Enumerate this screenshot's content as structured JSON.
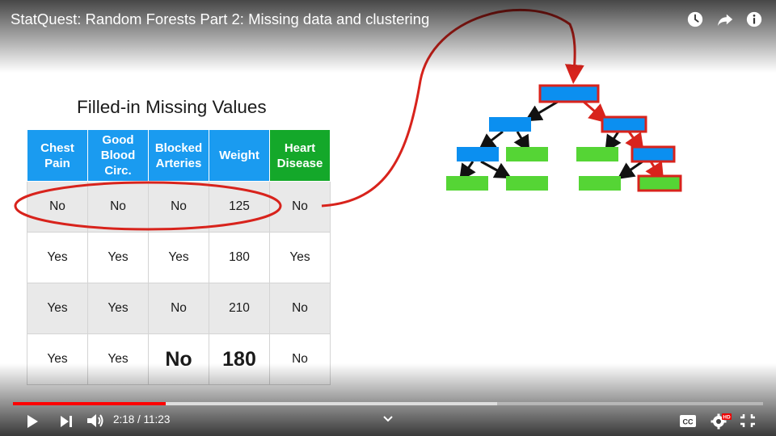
{
  "video": {
    "title": "StatQuest: Random Forests Part 2: Missing data and clustering",
    "current_time": "2:18",
    "separator": " / ",
    "duration": "11:23",
    "progress_fraction": 0.204,
    "buffered_fraction": 0.645
  },
  "slide": {
    "title": "Filled-in Missing Values",
    "headers": [
      "Chest\nPain",
      "Good\nBlood\nCirc.",
      "Blocked\nArteries",
      "Weight",
      "Heart\nDisease"
    ],
    "rows": [
      [
        "No",
        "No",
        "No",
        "125",
        "No"
      ],
      [
        "Yes",
        "Yes",
        "Yes",
        "180",
        "Yes"
      ],
      [
        "Yes",
        "Yes",
        "No",
        "210",
        "No"
      ],
      [
        "Yes",
        "Yes",
        "No",
        "180",
        "No"
      ]
    ]
  },
  "colors": {
    "header_blue": "#1a9bf0",
    "header_green": "#14a82a",
    "highlight_red": "#d8231c",
    "node_blue": "#0b8ff0",
    "node_green": "#55d535",
    "progress_red": "#ff0000"
  },
  "icons": {
    "top": [
      "watch-later-icon",
      "share-icon",
      "info-icon"
    ],
    "controls": [
      "play-icon",
      "next-icon",
      "volume-icon",
      "chevron-down-icon",
      "captions-icon",
      "settings-hd-icon",
      "exit-fullscreen-icon"
    ]
  }
}
